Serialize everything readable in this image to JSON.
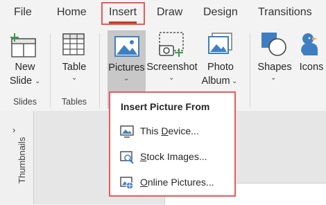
{
  "tabs": [
    "File",
    "Home",
    "Insert",
    "Draw",
    "Design",
    "Transitions"
  ],
  "ribbon": {
    "new_slide": [
      "New",
      "Slide"
    ],
    "table": "Table",
    "pictures": "Pictures",
    "screenshot": "Screenshot",
    "photo_album": [
      "Photo",
      "Album"
    ],
    "shapes": "Shapes",
    "icons": "Icons",
    "groups": {
      "slides": "Slides",
      "tables": "Tables"
    }
  },
  "side_panel": {
    "thumbnails_label": "Thumbnails"
  },
  "dropdown": {
    "title": "Insert Picture From",
    "items": [
      {
        "accel": "D",
        "rest_before": "This ",
        "rest_after": "evice...",
        "label": "This Device..."
      },
      {
        "accel": "S",
        "rest_before": "",
        "rest_after": "tock Images...",
        "label": "Stock Images..."
      },
      {
        "accel": "O",
        "rest_before": "",
        "rest_after": "nline Pictures...",
        "label": "Online Pictures..."
      }
    ]
  },
  "colors": {
    "accent_red": "#c43e1c",
    "highlight_border": "#e8595a",
    "icon_blue": "#3f7fc1",
    "icon_green": "#3a9b4a"
  }
}
